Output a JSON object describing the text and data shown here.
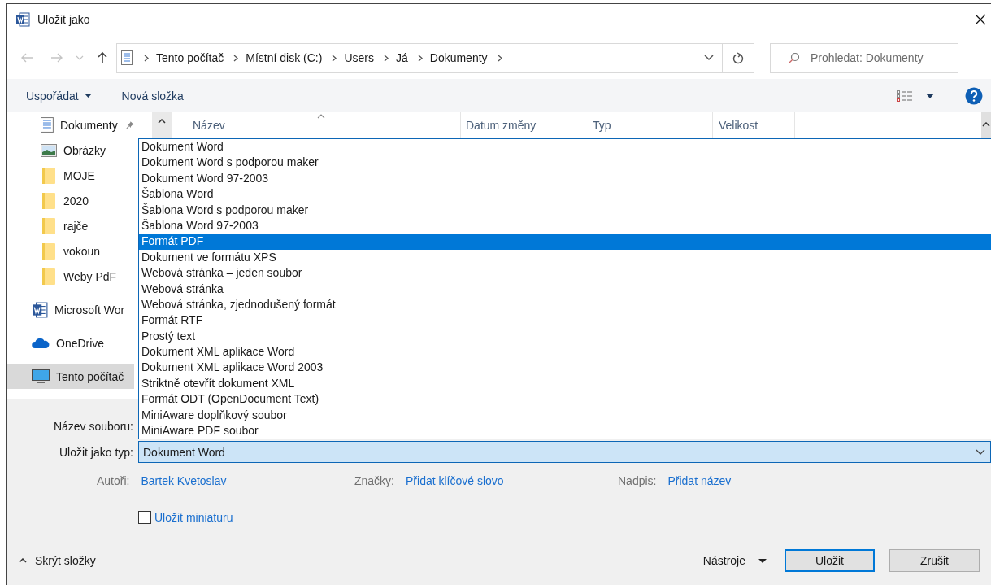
{
  "window": {
    "title": "Uložit jako"
  },
  "navigation": {
    "path": [
      "Tento počítač",
      "Místní disk (C:)",
      "Users",
      "Já",
      "Dokumenty"
    ]
  },
  "search": {
    "placeholder": "Prohledat: Dokumenty"
  },
  "toolbar": {
    "organize": "Uspořádat",
    "new_folder": "Nová složka"
  },
  "sidebar": {
    "quick_access": [
      {
        "label": "Dokumenty",
        "kind": "documents",
        "pinned": true,
        "selected": false
      },
      {
        "label": "Obrázky",
        "kind": "pictures",
        "pinned": false,
        "selected": false
      },
      {
        "label": "MOJE",
        "kind": "folder",
        "pinned": false,
        "selected": false
      },
      {
        "label": "2020",
        "kind": "folder",
        "pinned": false,
        "selected": false
      },
      {
        "label": "rajče",
        "kind": "folder",
        "pinned": false,
        "selected": false
      },
      {
        "label": "vokoun",
        "kind": "folder",
        "pinned": false,
        "selected": false
      },
      {
        "label": "Weby PdF",
        "kind": "folder",
        "pinned": false,
        "selected": false
      }
    ],
    "locations": [
      {
        "label": "Microsoft Wor",
        "kind": "word",
        "selected": false
      },
      {
        "label": "OneDrive",
        "kind": "cloud",
        "selected": false
      },
      {
        "label": "Tento počítač",
        "kind": "computer",
        "selected": true
      }
    ]
  },
  "file_list": {
    "columns": [
      {
        "label": "Název",
        "sorted": true
      },
      {
        "label": "Datum změny",
        "sorted": false
      },
      {
        "label": "Typ",
        "sorted": false
      },
      {
        "label": "Velikost",
        "sorted": false
      }
    ]
  },
  "type_dropdown": {
    "options": [
      {
        "label": "Dokument Word",
        "selected": false
      },
      {
        "label": "Dokument Word s podporou maker",
        "selected": false
      },
      {
        "label": "Dokument Word 97-2003",
        "selected": false
      },
      {
        "label": "Šablona Word",
        "selected": false
      },
      {
        "label": "Šablona Word s podporou maker",
        "selected": false
      },
      {
        "label": "Šablona Word 97-2003",
        "selected": false
      },
      {
        "label": "Formát PDF",
        "selected": true
      },
      {
        "label": "Dokument ve formátu XPS",
        "selected": false
      },
      {
        "label": "Webová stránka – jeden soubor",
        "selected": false
      },
      {
        "label": "Webová stránka",
        "selected": false
      },
      {
        "label": "Webová stránka, zjednodušený formát",
        "selected": false
      },
      {
        "label": "Formát RTF",
        "selected": false
      },
      {
        "label": "Prostý text",
        "selected": false
      },
      {
        "label": "Dokument XML aplikace Word",
        "selected": false
      },
      {
        "label": "Dokument XML aplikace Word 2003",
        "selected": false
      },
      {
        "label": "Striktně otevřít dokument XML",
        "selected": false
      },
      {
        "label": "Formát ODT (OpenDocument Text)",
        "selected": false
      },
      {
        "label": "MiniAware doplňkový soubor",
        "selected": false
      },
      {
        "label": "MiniAware PDF soubor",
        "selected": false
      }
    ]
  },
  "form": {
    "file_name": {
      "label": "Název souboru:"
    },
    "file_type": {
      "label": "Uložit jako typ:",
      "value": "Dokument Word"
    }
  },
  "metadata": [
    {
      "label": "Autoři:",
      "value": "Bartek Kvetoslav"
    },
    {
      "label": "Značky:",
      "value": "Přidat klíčové slovo"
    },
    {
      "label": "Nadpis:",
      "value": "Přidat název"
    }
  ],
  "thumbnail": {
    "label": "Uložit miniaturu",
    "checked": false
  },
  "footer": {
    "hide_folders": "Skrýt složky",
    "tools": "Nástroje",
    "buttons": [
      {
        "label": "Uložit",
        "default": true
      },
      {
        "label": "Zrušit",
        "default": false
      }
    ]
  }
}
